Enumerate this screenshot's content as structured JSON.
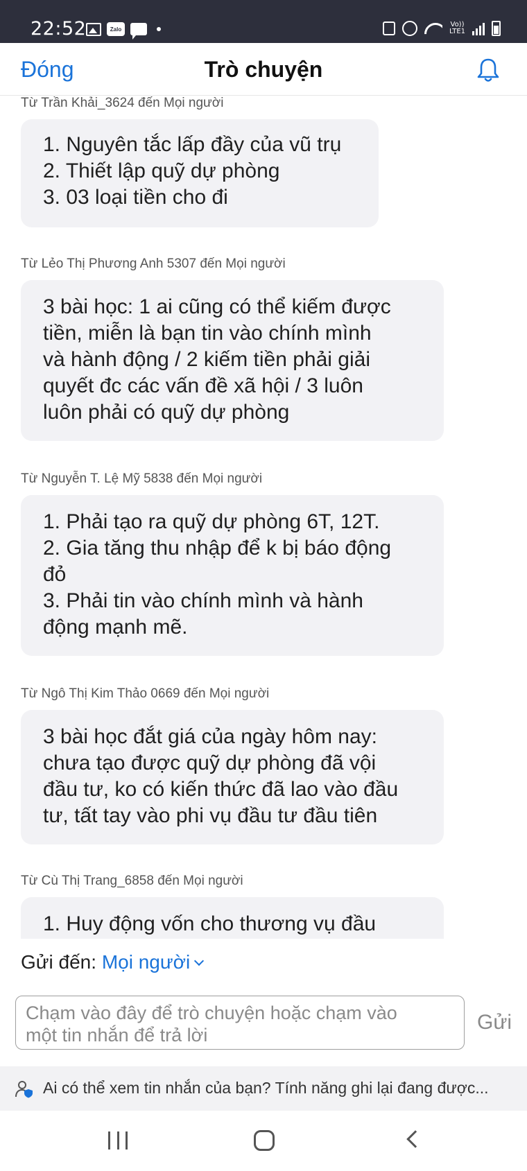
{
  "status_bar": {
    "time": "22:52",
    "zalo_label": "Zalo",
    "lte_label_top": "Vo))",
    "lte_label_bottom": "LTE1",
    "icons": [
      "gallery-icon",
      "zalo-icon",
      "chat-notification-icon",
      "dot-icon",
      "nfc-box-icon",
      "alarm-icon",
      "wifi-icon",
      "lte-icon",
      "signal-icon",
      "battery-icon"
    ]
  },
  "header": {
    "close_label": "Đóng",
    "title": "Trò chuyện",
    "bell_icon": "bell-icon"
  },
  "messages": [
    {
      "sender": "Từ Trần Khải_3624 đến Mọi người",
      "lines": [
        "1. Nguyên tắc lấp đầy của vũ trụ",
        "2. Thiết lập quỹ dự phòng",
        "3. 03 loại tiền cho đi"
      ]
    },
    {
      "sender": "Từ Lẻo Thị Phương Anh 5307 đến Mọi người",
      "lines": [
        "3 bài học: 1 ai cũng có thể kiếm được",
        "tiền, miễn là bạn tin vào chính mình",
        "và hành động / 2 kiếm tiền phải giải",
        "quyết đc các vấn đề xã hội / 3 luôn",
        "luôn phải có quỹ dự phòng"
      ]
    },
    {
      "sender": "Từ Nguyễn T. Lệ Mỹ 5838 đến Mọi người",
      "lines": [
        "1. Phải tạo ra quỹ dự phòng 6T, 12T.",
        "2. Gia tăng thu nhập để k bị báo động",
        "đỏ",
        "3. Phải tin vào chính mình và hành",
        "động mạnh mẽ."
      ]
    },
    {
      "sender": "Từ Ngô Thị Kim Thảo 0669 đến Mọi người",
      "lines": [
        "3 bài học đắt giá của ngày hôm nay:",
        "chưa tạo được quỹ dự phòng đã vội",
        "đầu tư,  ko có kiến thức đã lao vào đầu",
        "tư, tất tay vào phi vụ đầu tư đầu tiên"
      ]
    },
    {
      "sender": "Từ Cù Thị Trang_6858 đến Mọi người",
      "lines": [
        "1. Huy động vốn cho thương vụ đầu"
      ]
    }
  ],
  "composer": {
    "send_to_label": "Gửi đến:",
    "send_to_value": "Mọi người",
    "input_placeholder_line1": "Chạm vào đây để trò chuyện hoặc chạm vào",
    "input_placeholder_line2": "một tin nhắn để trả lời",
    "send_label": "Gửi"
  },
  "notice": {
    "text": "Ai có thể xem tin nhắn của bạn? Tính năng ghi lại đang được..."
  },
  "colors": {
    "accent": "#1a73d9",
    "status_bar_bg": "#2d2f3c",
    "bubble_bg": "#f2f2f5"
  }
}
